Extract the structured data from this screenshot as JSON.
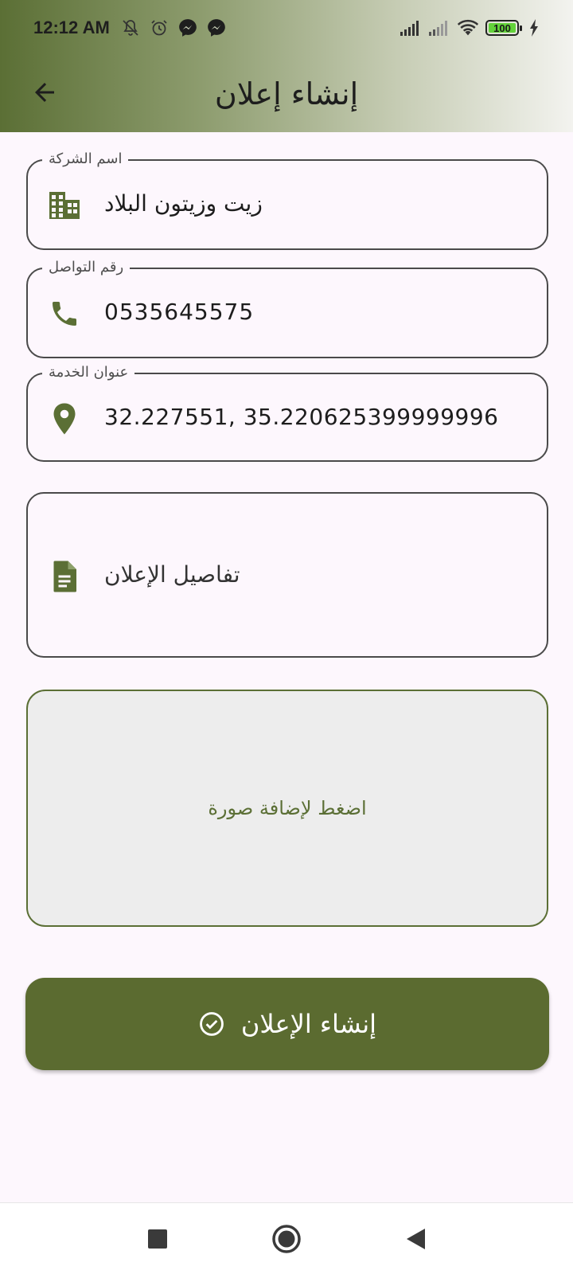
{
  "status_bar": {
    "time": "12:12 AM",
    "battery": "100",
    "icons_left": [
      "mute-bell-icon",
      "alarm-icon",
      "messenger-icon",
      "messenger-icon"
    ],
    "icons_right": [
      "signal-icon",
      "signal-icon",
      "wifi-icon",
      "battery-icon",
      "charging-icon"
    ]
  },
  "header": {
    "title": "إنشاء إعلان",
    "back_icon": "arrow-back-icon",
    "gradient_start": "#5b6f35",
    "gradient_end": "#f3f3ef"
  },
  "form": {
    "company_name": {
      "label": "اسم الشركة",
      "value": "زيت وزيتون البلاد",
      "icon": "building-icon"
    },
    "contact_number": {
      "label": "رقم التواصل",
      "value": "0535645575",
      "icon": "phone-icon"
    },
    "service_address": {
      "label": "عنوان الخدمة",
      "value": "32.227551, 35.220625399999996",
      "icon": "location-pin-icon"
    },
    "ad_details": {
      "placeholder": "تفاصيل الإعلان",
      "icon": "document-icon"
    }
  },
  "image_upload": {
    "label": "اضغط لإضافة صورة"
  },
  "submit_button": {
    "label": "إنشاء الإعلان",
    "icon": "check-circle-icon"
  },
  "nav_bar": {
    "icons": [
      "recents-square-icon",
      "home-circle-icon",
      "back-triangle-icon"
    ]
  },
  "colors": {
    "accent": "#5b6f35",
    "button": "#5b6b30",
    "background": "#fdf7fd",
    "upload_bg": "#ededed"
  }
}
